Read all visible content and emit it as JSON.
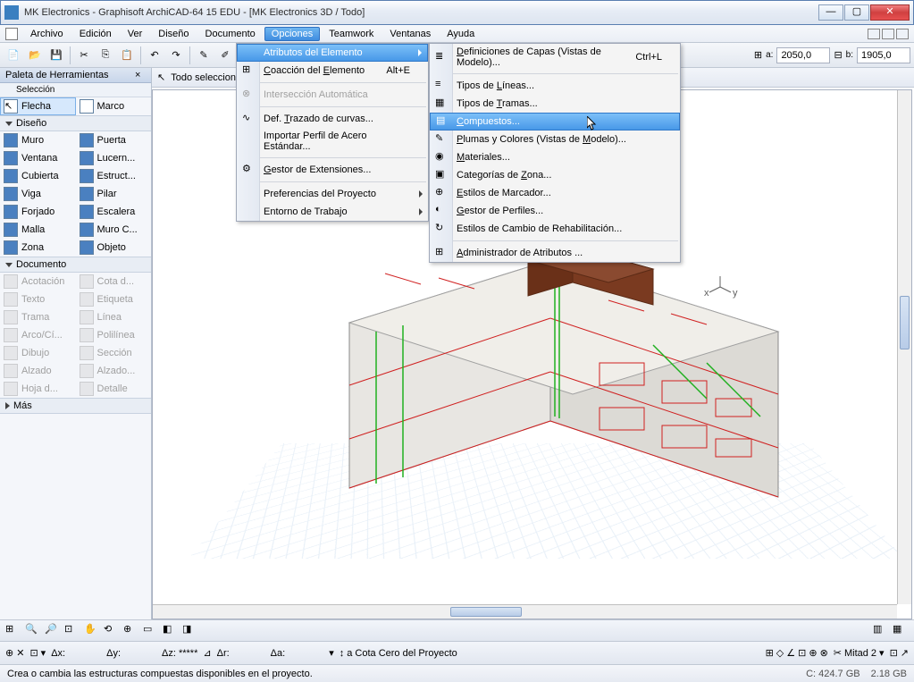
{
  "title": "MK Electronics - Graphisoft ArchiCAD-64 15 EDU - [MK Electronics 3D / Todo]",
  "menu": {
    "archivo": "Archivo",
    "edicion": "Edición",
    "ver": "Ver",
    "diseno": "Diseño",
    "documento": "Documento",
    "opciones": "Opciones",
    "teamwork": "Teamwork",
    "ventanas": "Ventanas",
    "ayuda": "Ayuda"
  },
  "opciones_menu": {
    "atributos": "Atributos del Elemento",
    "coaccion": "Coacción del Elemento",
    "coaccion_sc": "Alt+E",
    "interseccion": "Intersección Automática",
    "trazado": "Def. Trazado de curvas...",
    "perfil_acero": "Importar Perfil de Acero Estándar...",
    "gestor_ext": "Gestor de Extensiones...",
    "pref_proyecto": "Preferencias del Proyecto",
    "entorno": "Entorno de Trabajo"
  },
  "atributos_submenu": {
    "def_capas": "Definiciones de Capas (Vistas de Modelo)...",
    "def_capas_sc": "Ctrl+L",
    "tipos_lineas": "Tipos de Líneas...",
    "tipos_tramas": "Tipos de Tramas...",
    "compuestos": "Compuestos...",
    "plumas": "Plumas y Colores (Vistas de Modelo)...",
    "materiales": "Materiales...",
    "cat_zona": "Categorías de Zona...",
    "estilos_marcador": "Estilos de Marcador...",
    "gestor_perfiles": "Gestor de Perfiles...",
    "estilos_rehab": "Estilos de Cambio de Rehabilitación...",
    "admin_atributos": "Administrador de Atributos ..."
  },
  "palette": {
    "title": "Paleta de Herramientas",
    "seleccion": "Selección",
    "flecha": "Flecha",
    "marco": "Marco",
    "diseno": "Diseño",
    "muro": "Muro",
    "puerta": "Puerta",
    "ventana": "Ventana",
    "lucern": "Lucern...",
    "cubierta": "Cubierta",
    "estruct": "Estruct...",
    "viga": "Viga",
    "pilar": "Pilar",
    "forjado": "Forjado",
    "escalera": "Escalera",
    "malla": "Malla",
    "muro_c": "Muro C...",
    "zona": "Zona",
    "objeto": "Objeto",
    "documento": "Documento",
    "acotacion": "Acotación",
    "cota_d": "Cota d...",
    "texto": "Texto",
    "etiqueta": "Etiqueta",
    "trama": "Trama",
    "linea": "Línea",
    "arco": "Arco/Cí...",
    "polilinea": "Polilínea",
    "dibujo": "Dibujo",
    "seccion": "Sección",
    "alzado": "Alzado",
    "alzado2": "Alzado...",
    "hoja": "Hoja d...",
    "detalle": "Detalle",
    "mas": "Más"
  },
  "infobar": {
    "todo_sel": "Todo seleccionado:"
  },
  "coords": {
    "a_label": "a:",
    "a_val": "2050,0",
    "b_label": "b:",
    "b_val": "1905,0"
  },
  "bottom_readout": {
    "dx": "Δx:",
    "dy": "Δy:",
    "dz": "Δz: *****",
    "dr": "Δr:",
    "da": "Δa:",
    "cota_cero": "a Cota Cero del Proyecto",
    "mitad": "Mitad",
    "mitad_n": "2"
  },
  "status": {
    "hint": "Crea o cambia las estructuras compuestas disponibles en el proyecto.",
    "disk_c": "C: 424.7 GB",
    "mem": "2.18 GB"
  }
}
